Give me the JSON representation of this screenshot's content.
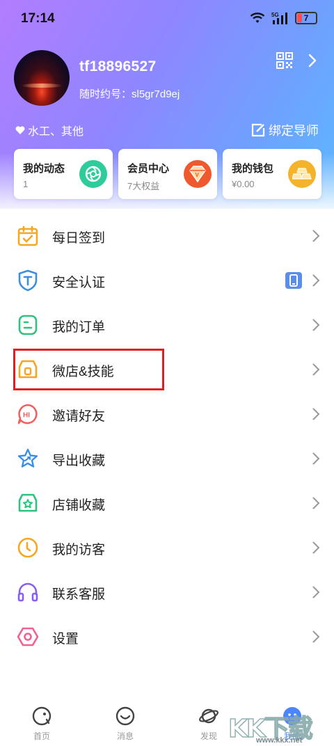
{
  "status_bar": {
    "time": "17:14",
    "battery": "7",
    "network": "5G"
  },
  "profile": {
    "username": "tf18896527",
    "user_id": "随时约号：sl5gr7d9ej",
    "tags": "水工、其他",
    "bind_label": "绑定导师"
  },
  "cards": [
    {
      "title": "我的动态",
      "sub": "1",
      "icon": "camera-aperture-icon",
      "color": "#2ecc9a"
    },
    {
      "title": "会员中心",
      "sub": "7大权益",
      "icon": "vip-diamond-icon",
      "color": "#f0592e"
    },
    {
      "title": "我的钱包",
      "sub": "¥0.00",
      "icon": "gold-bars-icon",
      "color": "#f5b32a"
    }
  ],
  "menu": [
    {
      "label": "每日签到",
      "icon": "calendar-check-icon",
      "color": "#f5a623"
    },
    {
      "label": "安全认证",
      "icon": "shield-t-icon",
      "color": "#3a8ee6"
    },
    {
      "label": "我的订单",
      "icon": "order-list-icon",
      "color": "#2ec27e"
    },
    {
      "label": "微店&技能",
      "icon": "shop-icon",
      "color": "#f5a623"
    },
    {
      "label": "邀请好友",
      "icon": "hi-bubble-icon",
      "color": "#f06060"
    },
    {
      "label": "导出收藏",
      "icon": "star-export-icon",
      "color": "#3a8ee6"
    },
    {
      "label": "店铺收藏",
      "icon": "store-star-icon",
      "color": "#2ec27e"
    },
    {
      "label": "我的访客",
      "icon": "clock-icon",
      "color": "#f5a623"
    },
    {
      "label": "联系客服",
      "icon": "headset-icon",
      "color": "#8a5cf0"
    },
    {
      "label": "设置",
      "icon": "settings-hex-icon",
      "color": "#f06090"
    }
  ],
  "tabs": [
    {
      "label": "首页",
      "icon": "home-face-icon"
    },
    {
      "label": "消息",
      "icon": "message-smile-icon"
    },
    {
      "label": "发现",
      "icon": "planet-icon"
    },
    {
      "label": "我的",
      "icon": "profile-icon",
      "active": true
    }
  ],
  "watermark": {
    "text": "KK下载",
    "sub": "www.kkx.net"
  },
  "colors": {
    "accent": "#4a86ff",
    "highlight": "#e02020"
  }
}
